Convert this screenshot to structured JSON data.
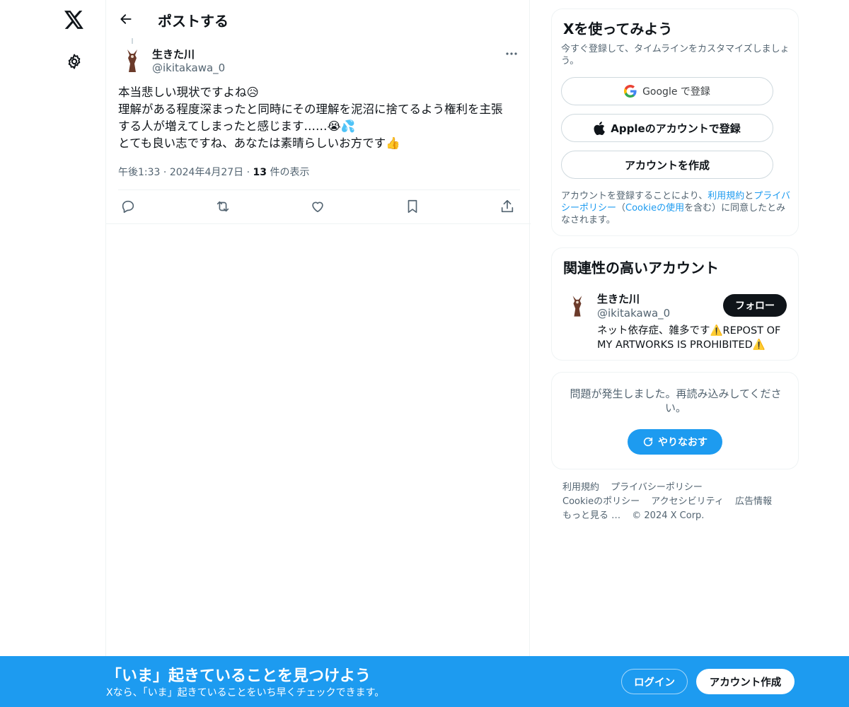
{
  "nav": {
    "logo_icon": "x-logo-icon",
    "settings_icon": "gear-icon"
  },
  "header": {
    "back_icon": "arrow-left-icon",
    "title": "ポストする"
  },
  "post": {
    "author_name": "生きた川",
    "author_handle": "@ikitakawa_0",
    "lines": [
      "本当悲しい現状ですよね😥",
      "理解がある程度深まったと同時にその理解を泥沼に捨てるよう権利を主張",
      "する人が増えてしまったと感じます……😭💦",
      "とても良い志ですね、あなたは素晴らしいお方です👍"
    ],
    "time": "午後1:33",
    "date": "2024年4月27日",
    "views_count": "13",
    "views_label": "件の表示",
    "actions": [
      "reply-icon",
      "repost-icon",
      "like-icon",
      "bookmark-icon",
      "share-icon"
    ]
  },
  "signup_card": {
    "title": "Xを使ってみよう",
    "subtitle": "今すぐ登録して、タイムラインをカスタマイズしましょう。",
    "google_label": "Google で登録",
    "apple_label": "Appleのアカウントで登録",
    "create_label": "アカウントを作成",
    "legal_prefix": "アカウントを登録することにより、",
    "legal_terms": "利用規約",
    "legal_and": "と",
    "legal_privacy": "プライバシーポリシー",
    "legal_open": "（",
    "legal_cookie": "Cookieの使用",
    "legal_suffix": "を含む）に同意したとみなされます。"
  },
  "suggest_card": {
    "title": "関連性の高いアカウント",
    "name": "生きた川",
    "handle": "@ikitakawa_0",
    "follow_label": "フォロー",
    "bio": "ネット依存症、雑多です⚠️REPOST OF MY ARTWORKS IS PROHIBITED⚠️"
  },
  "error_card": {
    "message": "問題が発生しました。再読み込みしてください。",
    "retry_label": "やりなおす"
  },
  "footer": {
    "links": [
      "利用規約",
      "プライバシーポリシー",
      "Cookieのポリシー",
      "アクセシビリティ",
      "広告情報",
      "もっと見る …"
    ],
    "copyright": "© 2024 X Corp."
  },
  "banner": {
    "title": "「いま」起きていることを見つけよう",
    "subtitle": "Xなら、「いま」起きていることをいち早くチェックできます。",
    "login_label": "ログイン",
    "signup_label": "アカウント作成"
  },
  "colors": {
    "accent": "#1d9bf0",
    "text": "#0f1419",
    "secondary": "#536471",
    "border": "#eff3f4"
  }
}
